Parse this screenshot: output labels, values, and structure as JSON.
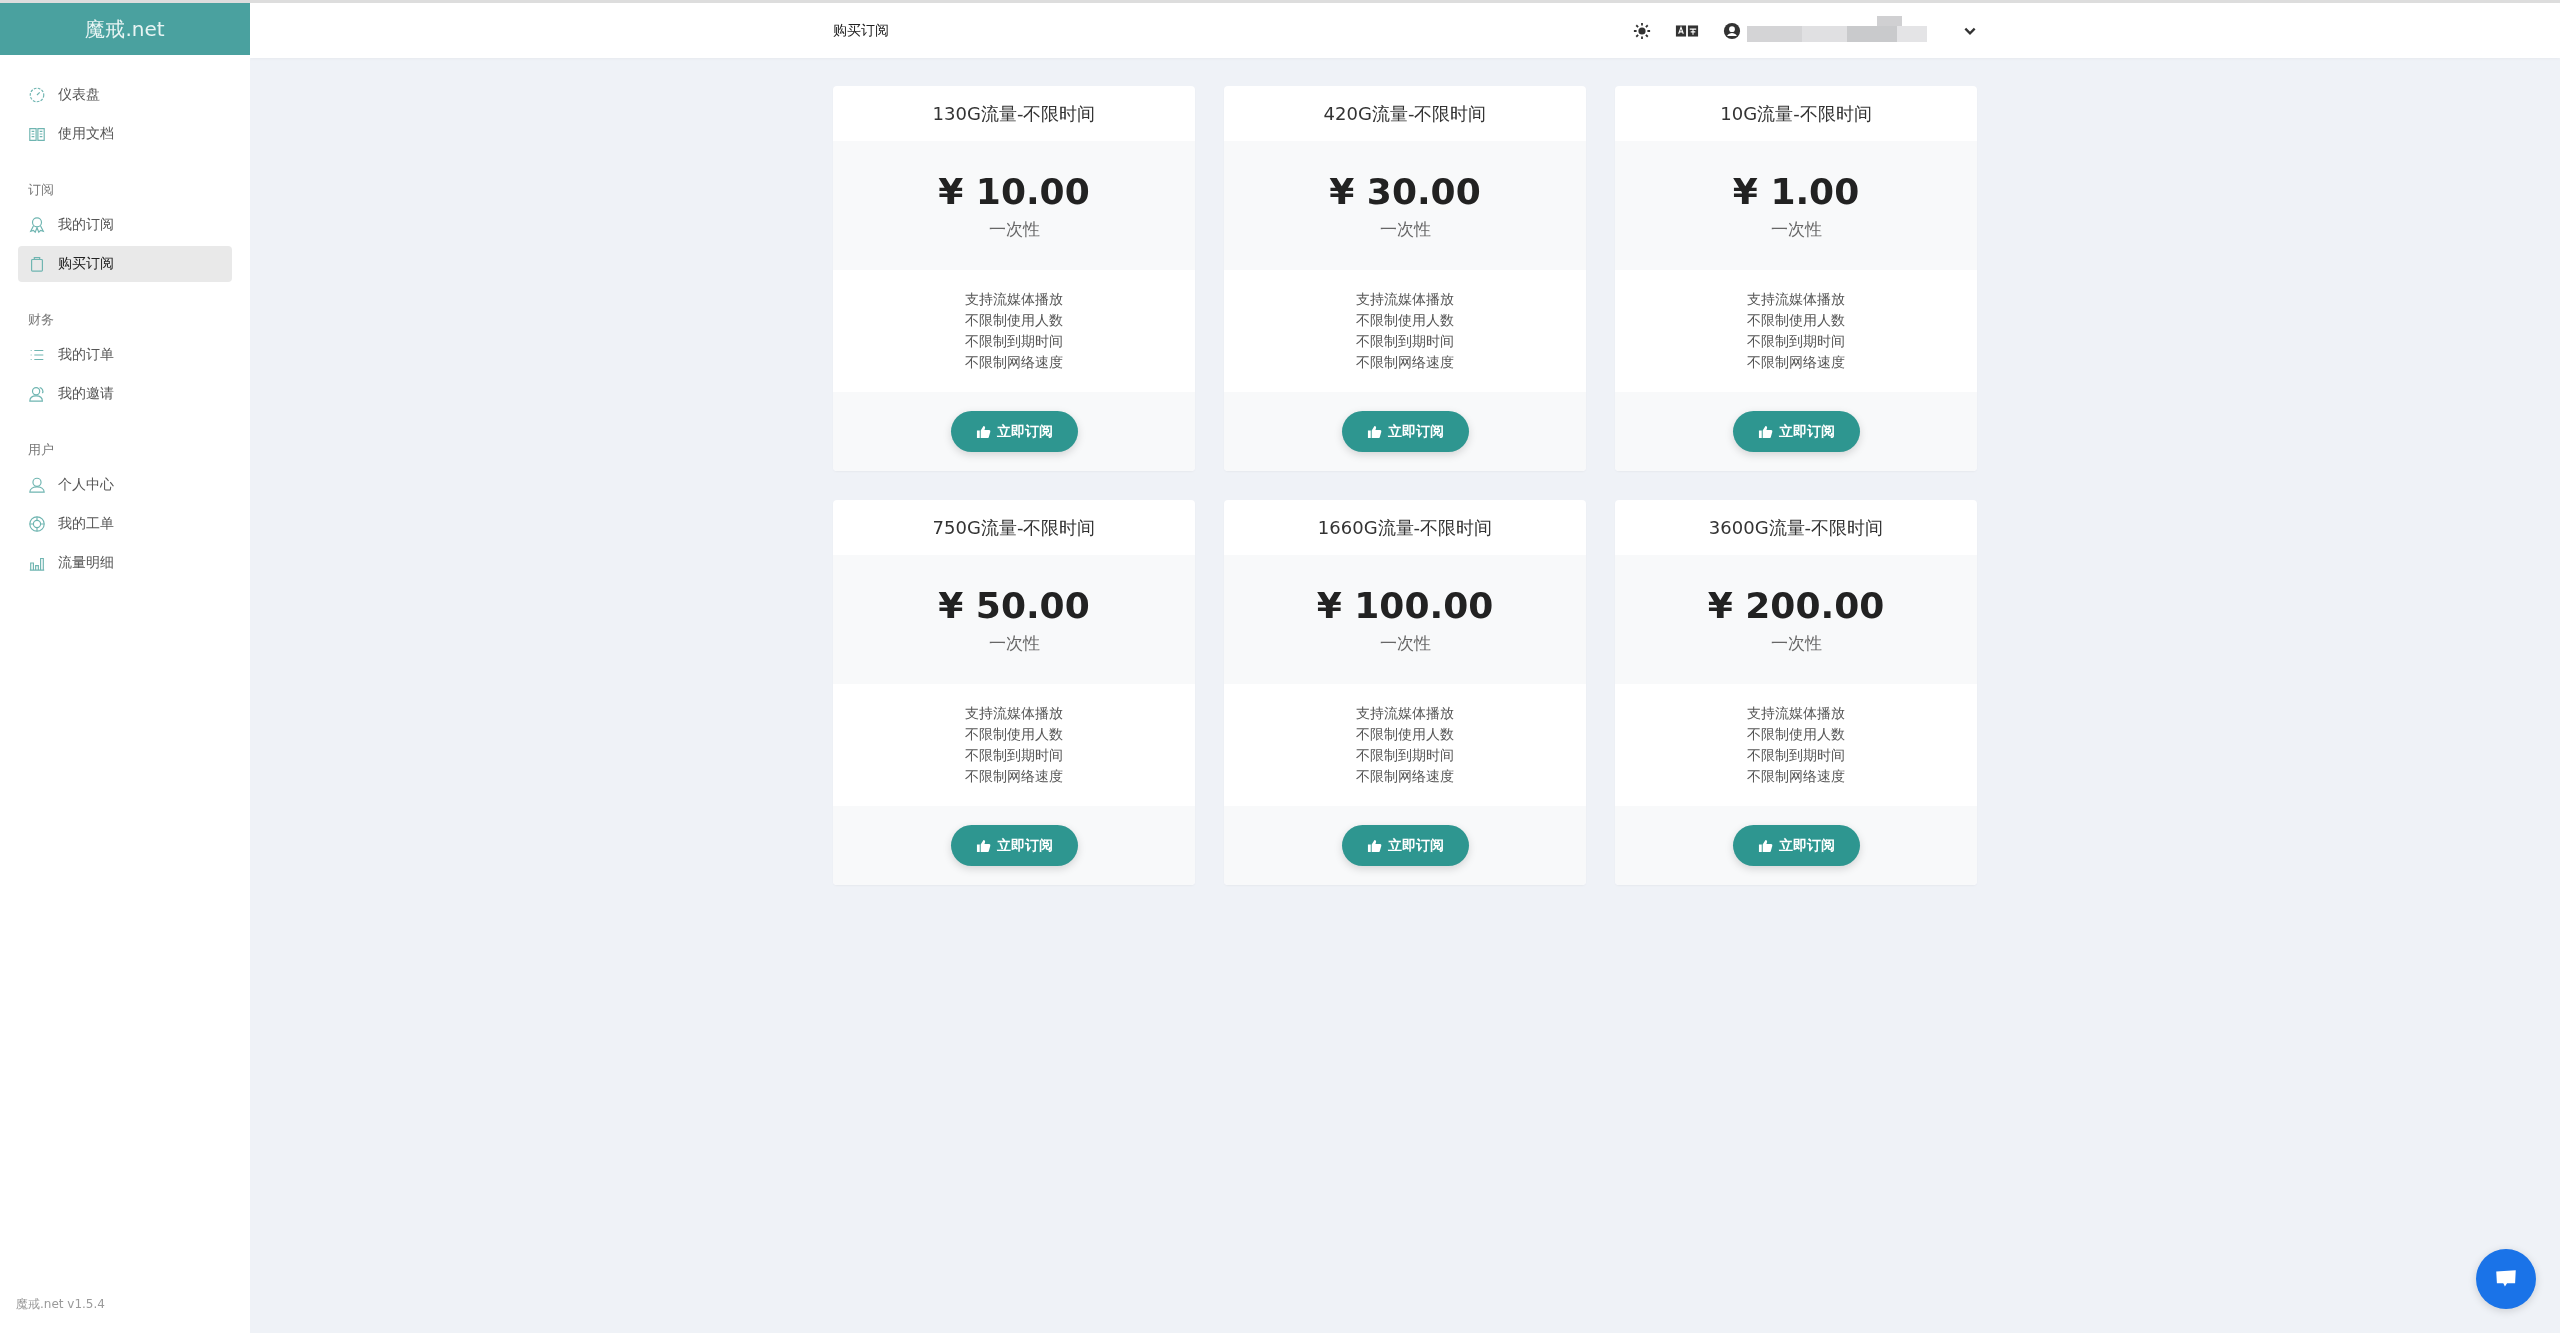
{
  "brand": "魔戒.net",
  "sidebar": {
    "groups": [
      {
        "items": [
          {
            "label": "仪表盘",
            "selected": false
          },
          {
            "label": "使用文档",
            "selected": false
          }
        ]
      },
      {
        "title": "订阅",
        "items": [
          {
            "label": "我的订阅",
            "selected": false
          },
          {
            "label": "购买订阅",
            "selected": true
          }
        ]
      },
      {
        "title": "财务",
        "items": [
          {
            "label": "我的订单",
            "selected": false
          },
          {
            "label": "我的邀请",
            "selected": false
          }
        ]
      },
      {
        "title": "用户",
        "items": [
          {
            "label": "个人中心",
            "selected": false
          },
          {
            "label": "我的工单",
            "selected": false
          },
          {
            "label": "流量明细",
            "selected": false
          }
        ]
      }
    ],
    "version": "魔戒.net v1.5.4"
  },
  "header": {
    "title": "购买订阅"
  },
  "plans": [
    {
      "name": "130G流量-不限时间",
      "price": "¥ 10.00",
      "period": "一次性",
      "features": [
        "支持流媒体播放",
        "不限制使用人数",
        "不限制到期时间",
        "不限制网络速度"
      ],
      "button": "立即订阅"
    },
    {
      "name": "420G流量-不限时间",
      "price": "¥ 30.00",
      "period": "一次性",
      "features": [
        "支持流媒体播放",
        "不限制使用人数",
        "不限制到期时间",
        "不限制网络速度"
      ],
      "button": "立即订阅"
    },
    {
      "name": "10G流量-不限时间",
      "price": "¥ 1.00",
      "period": "一次性",
      "features": [
        "支持流媒体播放",
        "不限制使用人数",
        "不限制到期时间",
        "不限制网络速度"
      ],
      "button": "立即订阅"
    },
    {
      "name": "750G流量-不限时间",
      "price": "¥ 50.00",
      "period": "一次性",
      "features": [
        "支持流媒体播放",
        "不限制使用人数",
        "不限制到期时间",
        "不限制网络速度"
      ],
      "button": "立即订阅"
    },
    {
      "name": "1660G流量-不限时间",
      "price": "¥ 100.00",
      "period": "一次性",
      "features": [
        "支持流媒体播放",
        "不限制使用人数",
        "不限制到期时间",
        "不限制网络速度"
      ],
      "button": "立即订阅"
    },
    {
      "name": "3600G流量-不限时间",
      "price": "¥ 200.00",
      "period": "一次性",
      "features": [
        "支持流媒体播放",
        "不限制使用人数",
        "不限制到期时间",
        "不限制网络速度"
      ],
      "button": "立即订阅"
    }
  ]
}
